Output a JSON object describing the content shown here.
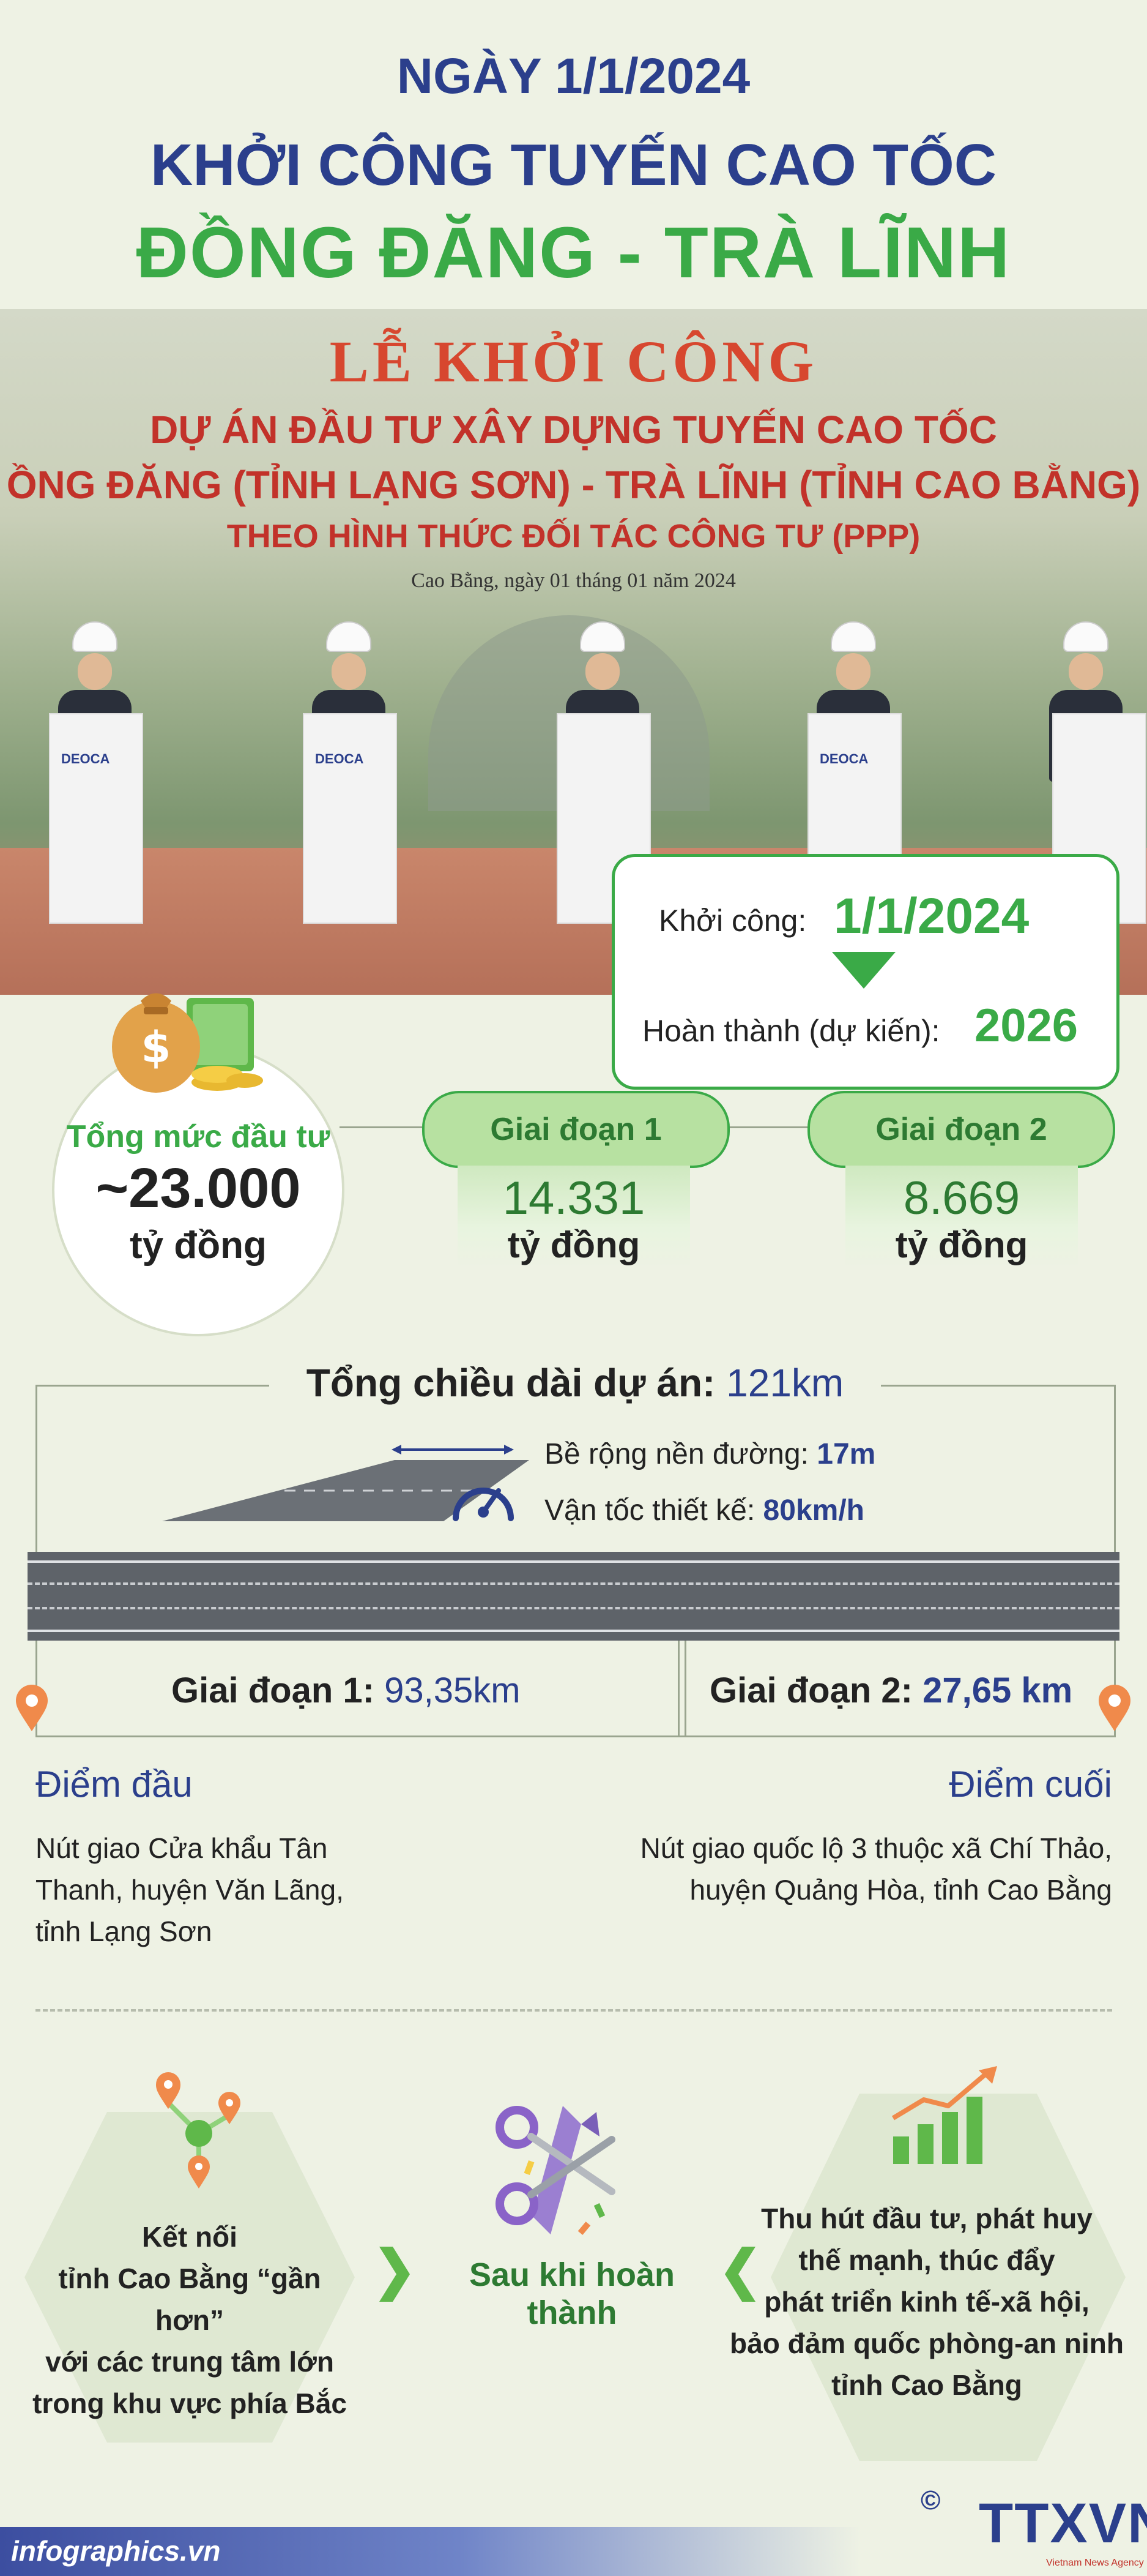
{
  "header": {
    "date_line": "NGÀY 1/1/2024",
    "line2": "KHỞI CÔNG TUYẾN CAO TỐC",
    "line3": "ĐỒNG ĐĂNG - TRÀ LĨNH"
  },
  "banner": {
    "title": "LỄ KHỞI CÔNG",
    "line1": "DỰ ÁN ĐẦU TƯ XÂY DỰNG TUYẾN CAO TỐC",
    "line2": "ỒNG ĐĂNG (TỈNH LẠNG SƠN) - TRÀ LĨNH (TỈNH CAO BẰNG)",
    "line3": "THEO HÌNH THỨC ĐỐI TÁC CÔNG TƯ (PPP)",
    "place_date": "Cao Bằng, ngày 01 tháng 01 năm 2024",
    "podium_logo": "DEOCA"
  },
  "dates": {
    "start_label": "Khởi công:",
    "start_value": "1/1/2024",
    "finish_label": "Hoàn thành (dự kiến):",
    "finish_value": "2026"
  },
  "investment": {
    "title": "Tổng mức đầu tư",
    "value": "~23.000",
    "unit": "tỷ đồng",
    "phases": [
      {
        "label": "Giai đoạn 1",
        "value": "14.331",
        "unit": "tỷ đồng"
      },
      {
        "label": "Giai đoạn 2",
        "value": "8.669",
        "unit": "tỷ đồng"
      }
    ]
  },
  "length": {
    "title_label": "Tổng chiều dài dự án:",
    "title_value": "121km",
    "width_label": "Bề rộng nền đường:",
    "width_value": "17m",
    "speed_label": "Vận tốc thiết kế:",
    "speed_value": "80km/h",
    "segment1_label": "Giai đoạn 1:",
    "segment1_value": "93,35km",
    "segment2_label": "Giai đoạn 2:",
    "segment2_value": "27,65 km"
  },
  "endpoints": {
    "start_heading": "Điểm đầu",
    "start_lines": [
      "Nút giao Cửa khẩu Tân",
      "Thanh, huyện Văn Lãng,",
      "tỉnh Lạng Sơn"
    ],
    "end_heading": "Điểm cuối",
    "end_lines": [
      "Nút giao quốc lộ 3 thuộc xã Chí Thảo,",
      "huyện Quảng Hòa, tỉnh Cao Bằng"
    ]
  },
  "benefits": {
    "center_label": "Sau khi hoàn thành",
    "left_lines": [
      "Kết nối",
      "tỉnh Cao Bằng “gần hơn”",
      "với các trung tâm lớn",
      "trong khu vực phía Bắc"
    ],
    "right_lines": [
      "Thu hút đầu tư, phát huy",
      "thế mạnh, thúc đẩy",
      "phát triển kinh tế-xã hội,",
      "bảo đảm quốc phòng-an ninh",
      "tỉnh Cao Bằng"
    ]
  },
  "footer": {
    "site": "infographics.vn",
    "copyright": "©",
    "logo": "TTXVN",
    "agency": "Vietnam News Agency"
  },
  "colors": {
    "navy": "#2b3f8c",
    "green": "#3aaa47",
    "light_green": "#b7e1a1",
    "red": "#c2322a",
    "orange": "#f08a4b",
    "background": "#eef2e4"
  },
  "icons": [
    "money-bag-icon",
    "gauge-icon",
    "location-pin-icon",
    "network-pins-icon",
    "scissors-ribbon-icon",
    "growth-chart-icon"
  ]
}
